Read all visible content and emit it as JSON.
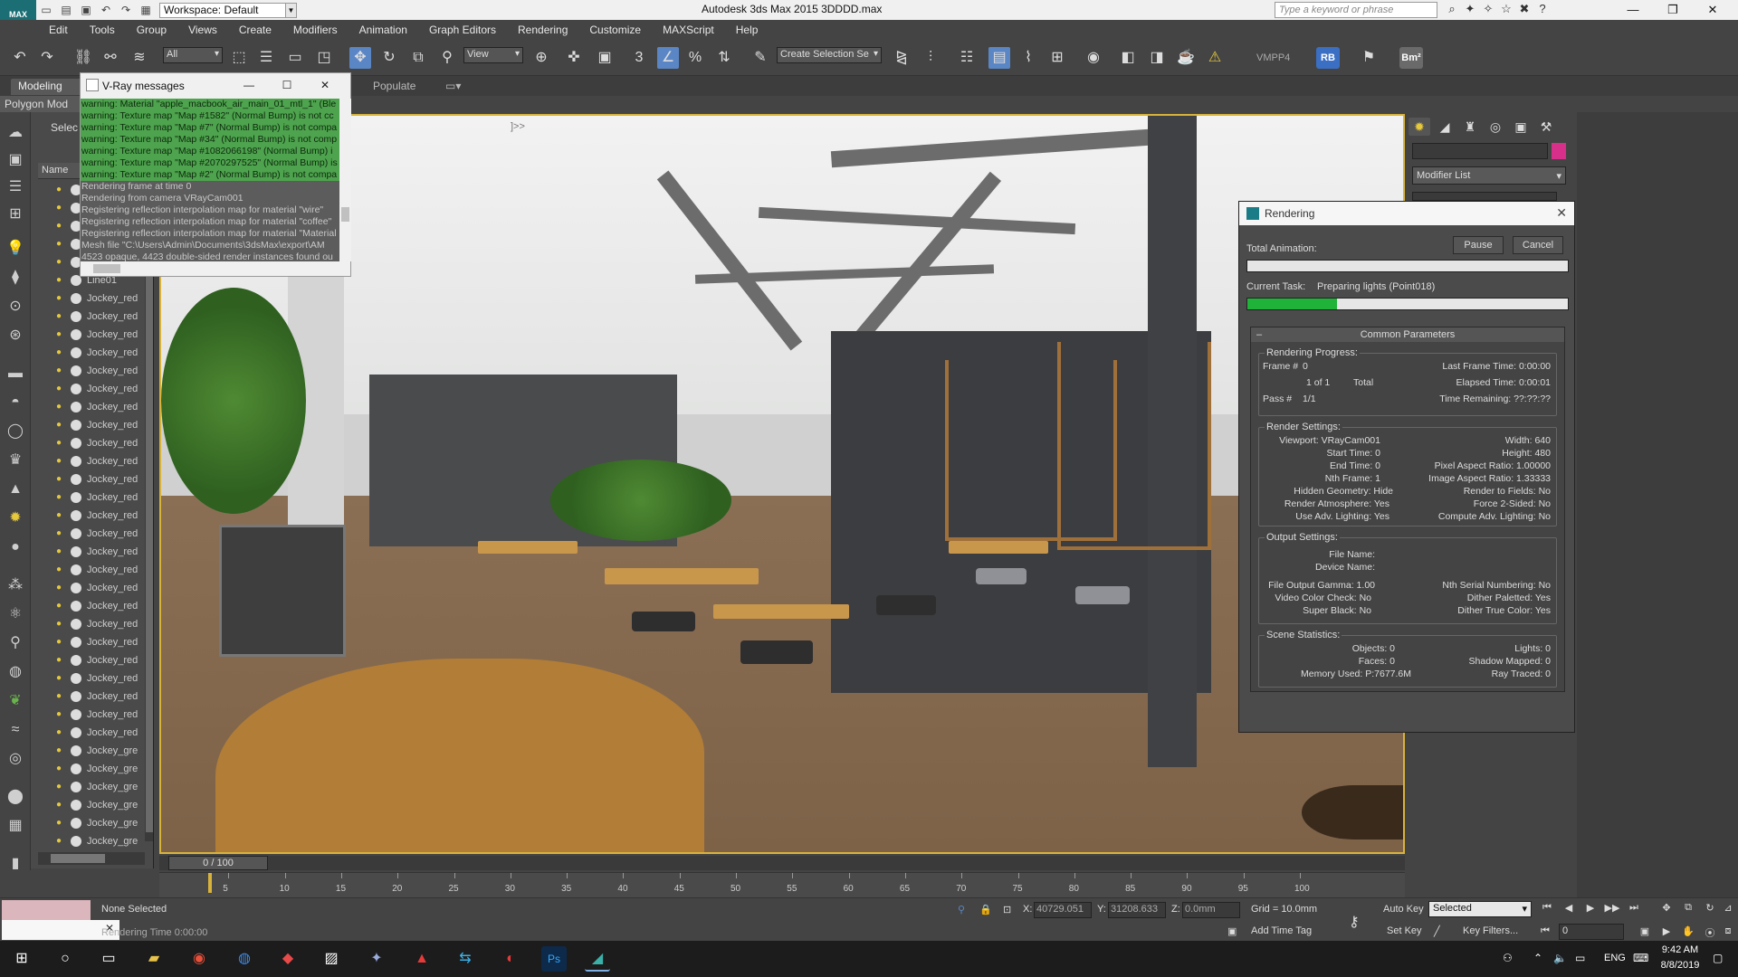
{
  "titlebar": {
    "logo": "MAX",
    "workspace": "Workspace: Default",
    "app_title": "Autodesk 3ds Max  2015     3DDDD.max",
    "search_placeholder": "Type a keyword or phrase",
    "minimize": "—",
    "restore": "❐",
    "close": "✕"
  },
  "menu": [
    "Edit",
    "Tools",
    "Group",
    "Views",
    "Create",
    "Modifiers",
    "Animation",
    "Graph Editors",
    "Rendering",
    "Customize",
    "MAXScript",
    "Help"
  ],
  "toolbar": {
    "selection_filter": "All",
    "reference_coord": "View",
    "named_selection": "Create Selection Se",
    "vmpp_label": "VMPP4",
    "rb_badge": "RB",
    "bm_badge": "Bm²",
    "snap_label": "3",
    "angle_snap_label": "%"
  },
  "ribbon": {
    "tabs": [
      "Modeling",
      "Populate"
    ],
    "sub": "Polygon Mod"
  },
  "scene_explorer": {
    "select_label": "Selec",
    "column_name": "Name",
    "items": [
      "",
      "",
      "",
      "",
      "",
      "Line01",
      "Jockey_red",
      "Jockey_red",
      "Jockey_red",
      "Jockey_red",
      "Jockey_red",
      "Jockey_red",
      "Jockey_red",
      "Jockey_red",
      "Jockey_red",
      "Jockey_red",
      "Jockey_red",
      "Jockey_red",
      "Jockey_red",
      "Jockey_red",
      "Jockey_red",
      "Jockey_red",
      "Jockey_red",
      "Jockey_red",
      "Jockey_red",
      "Jockey_red",
      "Jockey_red",
      "Jockey_red",
      "Jockey_red",
      "Jockey_red",
      "Jockey_red",
      "Jockey_gre",
      "Jockey_gre",
      "Jockey_gre",
      "Jockey_gre",
      "Jockey_gre",
      "Jockey_gre"
    ]
  },
  "viewport": {
    "label": "]>>"
  },
  "vray_messages": {
    "title": "V-Ray messages",
    "lines": [
      {
        "type": "warn",
        "text": "warning: Material \"apple_macbook_air_main_01_mtl_1\" (Ble"
      },
      {
        "type": "warn",
        "text": "warning: Texture map \"Map #1582\" (Normal Bump) is not cc"
      },
      {
        "type": "warn",
        "text": "warning: Texture map \"Map #7\" (Normal Bump) is not compa"
      },
      {
        "type": "warn",
        "text": "warning: Texture map \"Map #34\" (Normal Bump) is not comp"
      },
      {
        "type": "warn",
        "text": "warning: Texture map \"Map #1082066198\" (Normal Bump) i"
      },
      {
        "type": "warn",
        "text": "warning: Texture map \"Map #2070297525\" (Normal Bump) is"
      },
      {
        "type": "warn",
        "text": "warning: Texture map \"Map #2\" (Normal Bump) is not compa"
      },
      {
        "type": "info",
        "text": "Rendering frame at time 0"
      },
      {
        "type": "info",
        "text": "Rendering from camera VRayCam001"
      },
      {
        "type": "info",
        "text": "Registering reflection interpolation map for material \"wire\""
      },
      {
        "type": "info",
        "text": "Registering reflection interpolation map for material \"coffee\""
      },
      {
        "type": "info",
        "text": "Registering reflection interpolation map for material \"Material"
      },
      {
        "type": "info",
        "text": "Mesh file \"C:\\Users\\Admin\\Documents\\3dsMax\\export\\AM"
      },
      {
        "type": "info",
        "text": "4523 opaque, 4423 double-sided render instances found ou"
      }
    ]
  },
  "render_dialog": {
    "title": "Rendering",
    "total_animation_label": "Total Animation:",
    "pause": "Pause",
    "cancel": "Cancel",
    "current_task_label": "Current Task:",
    "current_task": "Preparing lights (Point018)",
    "total_progress": 0,
    "task_progress": 0.28,
    "rollout_title": "Common Parameters",
    "groups": {
      "progress": "Rendering Progress:",
      "settings": "Render Settings:",
      "output": "Output Settings:",
      "stats": "Scene Statistics:"
    },
    "progress": {
      "frame_label": "Frame #",
      "frame": "0",
      "of": "1 of 1",
      "total": "Total",
      "pass_label": "Pass #",
      "pass": "1/1",
      "last_frame_time": "Last Frame Time:  0:00:00",
      "elapsed_time": "Elapsed Time:  0:00:01",
      "time_remaining": "Time Remaining:  ??:??:??"
    },
    "settings": {
      "viewport": "Viewport:  VRayCam001",
      "start_time": "Start Time:  0",
      "end_time": "End Time:  0",
      "nth_frame": "Nth Frame:  1",
      "hidden_geometry": "Hidden Geometry:  Hide",
      "render_atmosphere": "Render Atmosphere:  Yes",
      "adv_lighting": "Use Adv. Lighting:  Yes",
      "width": "Width:  640",
      "height": "Height:  480",
      "pixel_aspect": "Pixel Aspect Ratio:  1.00000",
      "image_aspect": "Image Aspect Ratio:  1.33333",
      "render_fields": "Render to Fields:  No",
      "force_2sided": "Force 2-Sided:  No",
      "compute_adv": "Compute Adv. Lighting:  No"
    },
    "output": {
      "file_name": "File Name:",
      "device_name": "Device Name:",
      "gamma": "File Output Gamma:  1.00",
      "video_color": "Video Color Check:  No",
      "super_black": "Super Black:  No",
      "nth_serial": "Nth Serial Numbering:  No",
      "dither_paletted": "Dither Paletted:  Yes",
      "dither_true": "Dither True Color:  Yes"
    },
    "stats": {
      "objects": "Objects:  0",
      "faces": "Faces:  0",
      "memory": "Memory Used:  P:7677.6M",
      "lights": "Lights:  0",
      "shadow": "Shadow Mapped:  0",
      "ray_traced": "Ray Traced:  0"
    }
  },
  "command_panel": {
    "modifier_list": "Modifier List"
  },
  "timeline": {
    "slider": "0 / 100",
    "ticks": [
      "5",
      "10",
      "15",
      "20",
      "25",
      "30",
      "35",
      "40",
      "45",
      "50",
      "55",
      "60",
      "65",
      "70",
      "75",
      "80",
      "85",
      "90",
      "95",
      "100"
    ]
  },
  "status": {
    "selection": "None Selected",
    "render_time": "Rendering Time  0:00:00",
    "x_label": "X:",
    "x": "40729.051",
    "y_label": "Y:",
    "y": "31208.633",
    "z_label": "Z:",
    "z": "0.0mm",
    "grid": "Grid = 10.0mm",
    "add_time_tag": "Add Time Tag",
    "auto_key": "Auto Key",
    "set_key": "Set Key",
    "selected": "Selected",
    "key_filters": "Key Filters...",
    "frame": "0"
  },
  "taskbar": {
    "lang": "ENG",
    "time": "9:42 AM",
    "date": "8/8/2019"
  },
  "colors": {
    "accent": "#5a86c5",
    "progress": "#20b33a",
    "viewport_border": "#d8b33c",
    "log_warn": "#4ea34e"
  }
}
